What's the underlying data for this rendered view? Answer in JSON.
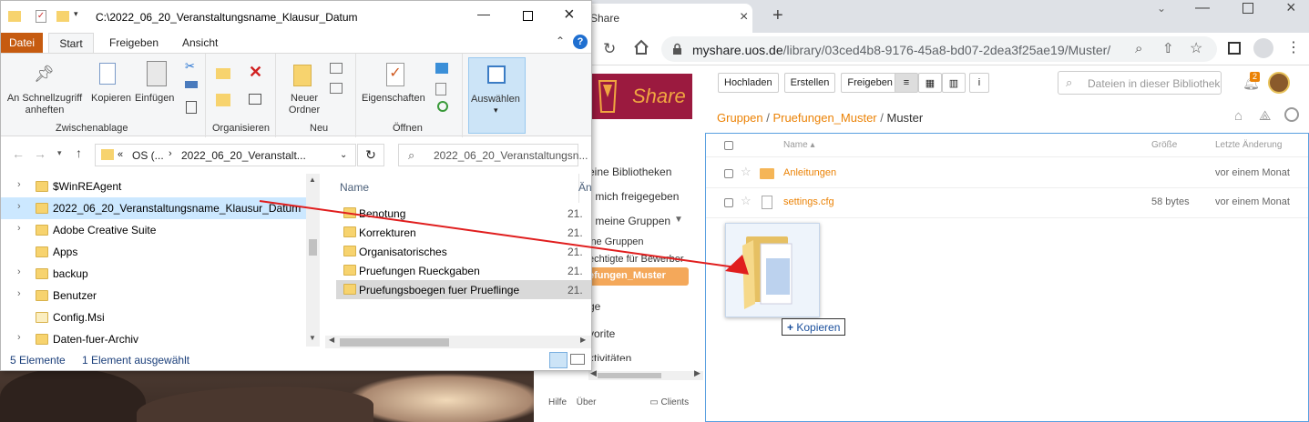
{
  "explorer": {
    "title_path": "C:\\2022_06_20_Veranstaltungsname_Klausur_Datum",
    "ribbon_tabs": [
      "Datei",
      "Start",
      "Freigeben",
      "Ansicht"
    ],
    "ribbon": {
      "pin_label": "An Schnellzugriff anheften",
      "copy_label": "Kopieren",
      "paste_label": "Einfügen",
      "group_clipboard": "Zwischenablage",
      "group_organize": "Organisieren",
      "new_folder_label": "Neuer Ordner",
      "group_new": "Neu",
      "properties_label": "Eigenschaften",
      "group_open": "Öffnen",
      "select_label": "Auswählen"
    },
    "breadcrumb": {
      "prefix": "«",
      "drive": "OS (...",
      "current": "2022_06_20_Veranstalt..."
    },
    "search_placeholder": "2022_06_20_Veranstaltungsn...",
    "tree_items": [
      "$WinREAgent",
      "2022_06_20_Veranstaltungsname_Klausur_Datum",
      "Adobe Creative Suite",
      "Apps",
      "backup",
      "Benutzer",
      "Config.Msi",
      "Daten-fuer-Archiv"
    ],
    "list_header": {
      "name": "Name",
      "date_short": "Än"
    },
    "list_items": [
      {
        "name": "Benotung",
        "date": "21."
      },
      {
        "name": "Korrekturen",
        "date": "21."
      },
      {
        "name": "Organisatorisches",
        "date": "21."
      },
      {
        "name": "Pruefungen Rueckgaben",
        "date": "21."
      },
      {
        "name": "Pruefungsboegen fuer Prueflinge",
        "date": "21."
      }
    ],
    "status_count": "5 Elemente",
    "status_selected": "1 Element ausgewählt"
  },
  "browser": {
    "tab_title": "Share",
    "url_host": "myshare.uos.de",
    "url_path": "/library/03ced4b8-9176-45a8-bd07-2dea3f25ae19/Muster/",
    "toolbar": {
      "upload_label": "Hochladen",
      "create_label": "Erstellen",
      "share_label": "Freigeben"
    },
    "search_placeholder": "Dateien in dieser Bibliothek",
    "notification_count": "2",
    "logo_text": "Share",
    "breadcrumb": [
      "Gruppen",
      "Pruefungen_Muster",
      "Muster"
    ],
    "sidebar": [
      "eine Bibliotheken",
      "r mich freigegeben",
      "r meine Gruppen",
      "ine Gruppen",
      "echtigte für Bewerber",
      "efungen_Muster",
      "ge",
      "vorite",
      "ktivitäten"
    ],
    "footer": {
      "help": "Hilfe",
      "about": "Über",
      "clients": "Clients"
    },
    "table_header": {
      "name": "Name",
      "size": "Größe",
      "modified": "Letzte Änderung"
    },
    "files": [
      {
        "name": "Anleitungen",
        "size": "",
        "modified": "vor einem Monat",
        "type": "folder"
      },
      {
        "name": "settings.cfg",
        "size": "58 bytes",
        "modified": "vor einem Monat",
        "type": "file"
      }
    ],
    "drag_tooltip": "Kopieren",
    "drag_tooltip_symbol": "+"
  },
  "colors": {
    "seafile_orange": "#eb8205",
    "share_logo_bg": "#9b1a3f",
    "drag_arrow": "#e01e1e",
    "explorer_file_tab": "#c65b10"
  }
}
